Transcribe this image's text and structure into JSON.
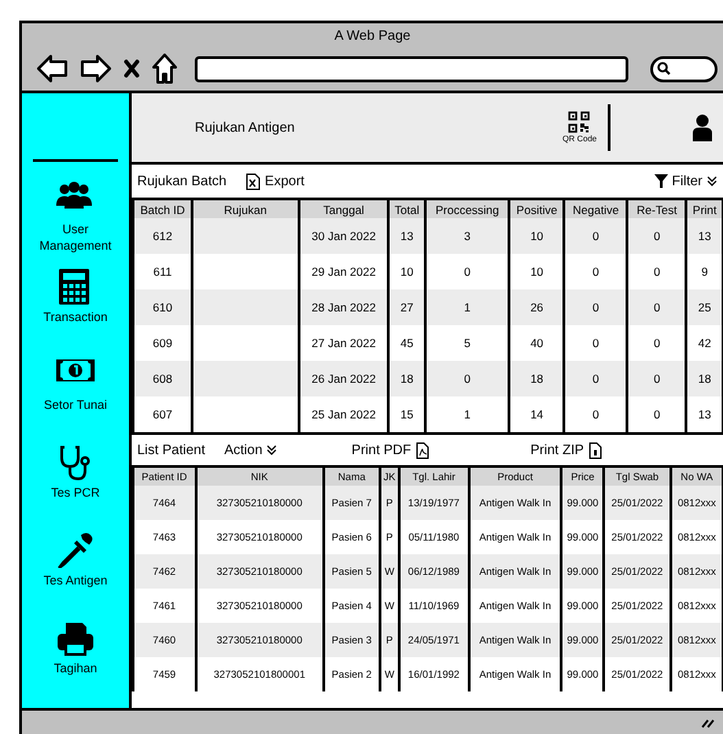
{
  "window": {
    "title": "A Web Page"
  },
  "sidebar": {
    "items": [
      {
        "label": "User Management"
      },
      {
        "label": "Transaction"
      },
      {
        "label": "Setor Tunai"
      },
      {
        "label": "Tes PCR"
      },
      {
        "label": "Tes Antigen"
      },
      {
        "label": "Tagihan"
      }
    ]
  },
  "header": {
    "title": "Rujukan Antigen",
    "qr_label": "QR Code"
  },
  "batch_section": {
    "title": "Rujukan Batch",
    "export": "Export",
    "filter": "Filter",
    "table": {
      "columns": [
        "Batch ID",
        "Rujukan",
        "Tanggal",
        "Total",
        "Proccessing",
        "Positive",
        "Negative",
        "Re-Test",
        "Print"
      ],
      "rows": [
        [
          "612",
          null,
          "30 Jan 2022",
          "13",
          "3",
          "10",
          "0",
          "0",
          "13"
        ],
        [
          "611",
          null,
          "29 Jan 2022",
          "10",
          "0",
          "10",
          "0",
          "0",
          "9"
        ],
        [
          "610",
          null,
          "28 Jan 2022",
          "27",
          "1",
          "26",
          "0",
          "0",
          "25"
        ],
        [
          "609",
          null,
          "27 Jan 2022",
          "45",
          "5",
          "40",
          "0",
          "0",
          "42"
        ],
        [
          "608",
          null,
          "26 Jan 2022",
          "18",
          "0",
          "18",
          "0",
          "0",
          "18"
        ],
        [
          "607",
          null,
          "25 Jan 2022",
          "15",
          "1",
          "14",
          "0",
          "0",
          "13"
        ]
      ]
    }
  },
  "patient_section": {
    "title": "List Patient",
    "action": "Action",
    "print_pdf": "Print PDF",
    "print_zip": "Print ZIP",
    "table": {
      "columns": [
        "Patient ID",
        "NIK",
        "Nama",
        "JK",
        "Tgl. Lahir",
        "Product",
        "Price",
        "Tgl Swab",
        "No WA"
      ],
      "rows": [
        [
          "7464",
          "327305210180000",
          "Pasien 7",
          "P",
          "13/19/1977",
          "Antigen Walk In",
          "99.000",
          "25/01/2022",
          "0812xxx"
        ],
        [
          "7463",
          "327305210180000",
          "Pasien 6",
          "P",
          "05/11/1980",
          "Antigen Walk In",
          "99.000",
          "25/01/2022",
          "0812xxx"
        ],
        [
          "7462",
          "327305210180000",
          "Pasien 5",
          "W",
          "06/12/1989",
          "Antigen Walk In",
          "99.000",
          "25/01/2022",
          "0812xxx"
        ],
        [
          "7461",
          "327305210180000",
          "Pasien 4",
          "W",
          "11/10/1969",
          "Antigen Walk In",
          "99.000",
          "25/01/2022",
          "0812xxx"
        ],
        [
          "7460",
          "327305210180000",
          "Pasien 3",
          "P",
          "24/05/1971",
          "Antigen Walk In",
          "99.000",
          "25/01/2022",
          "0812xxx"
        ],
        [
          "7459",
          "3273052101800001",
          "Pasien 2",
          "W",
          "16/01/1992",
          "Antigen Walk In",
          "99.000",
          "25/01/2022",
          "0812xxx"
        ]
      ]
    }
  }
}
